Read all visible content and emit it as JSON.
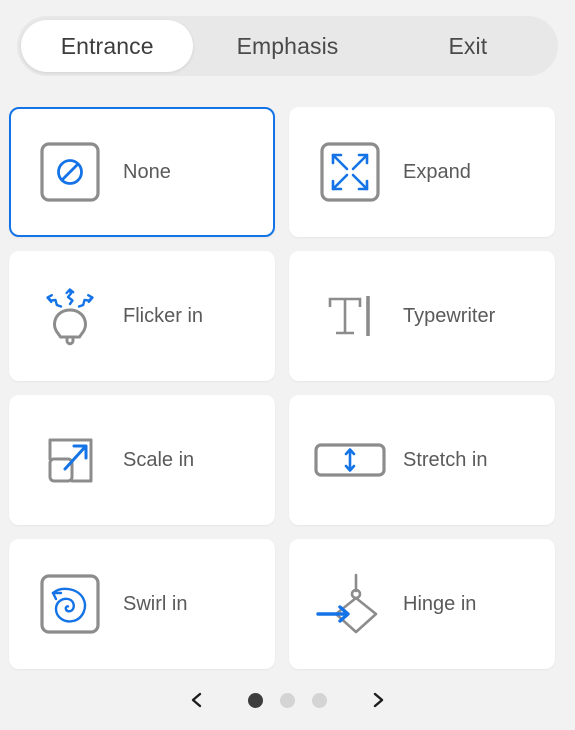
{
  "tabs": [
    {
      "label": "Entrance",
      "active": true
    },
    {
      "label": "Emphasis",
      "active": false
    },
    {
      "label": "Exit",
      "active": false
    }
  ],
  "effects": [
    {
      "label": "None",
      "icon": "none-icon",
      "selected": true
    },
    {
      "label": "Expand",
      "icon": "expand-icon",
      "selected": false
    },
    {
      "label": "Flicker in",
      "icon": "flicker-icon",
      "selected": false
    },
    {
      "label": "Typewriter",
      "icon": "typewriter-icon",
      "selected": false
    },
    {
      "label": "Scale in",
      "icon": "scale-icon",
      "selected": false
    },
    {
      "label": "Stretch in",
      "icon": "stretch-icon",
      "selected": false
    },
    {
      "label": "Swirl in",
      "icon": "swirl-icon",
      "selected": false
    },
    {
      "label": "Hinge in",
      "icon": "hinge-icon",
      "selected": false
    }
  ],
  "pagination": {
    "prev_icon": "chevron-left-icon",
    "next_icon": "chevron-right-icon",
    "total_pages": 3,
    "current_page": 1
  },
  "colors": {
    "accent": "#1473e6",
    "icon_gray": "#8c8c8c",
    "text": "#5a5a5a",
    "background": "#f2f2f2",
    "tabbar": "#e8e8e8",
    "card": "#ffffff",
    "dot_active": "#3d3d3d",
    "dot_inactive": "#d4d4d4"
  }
}
